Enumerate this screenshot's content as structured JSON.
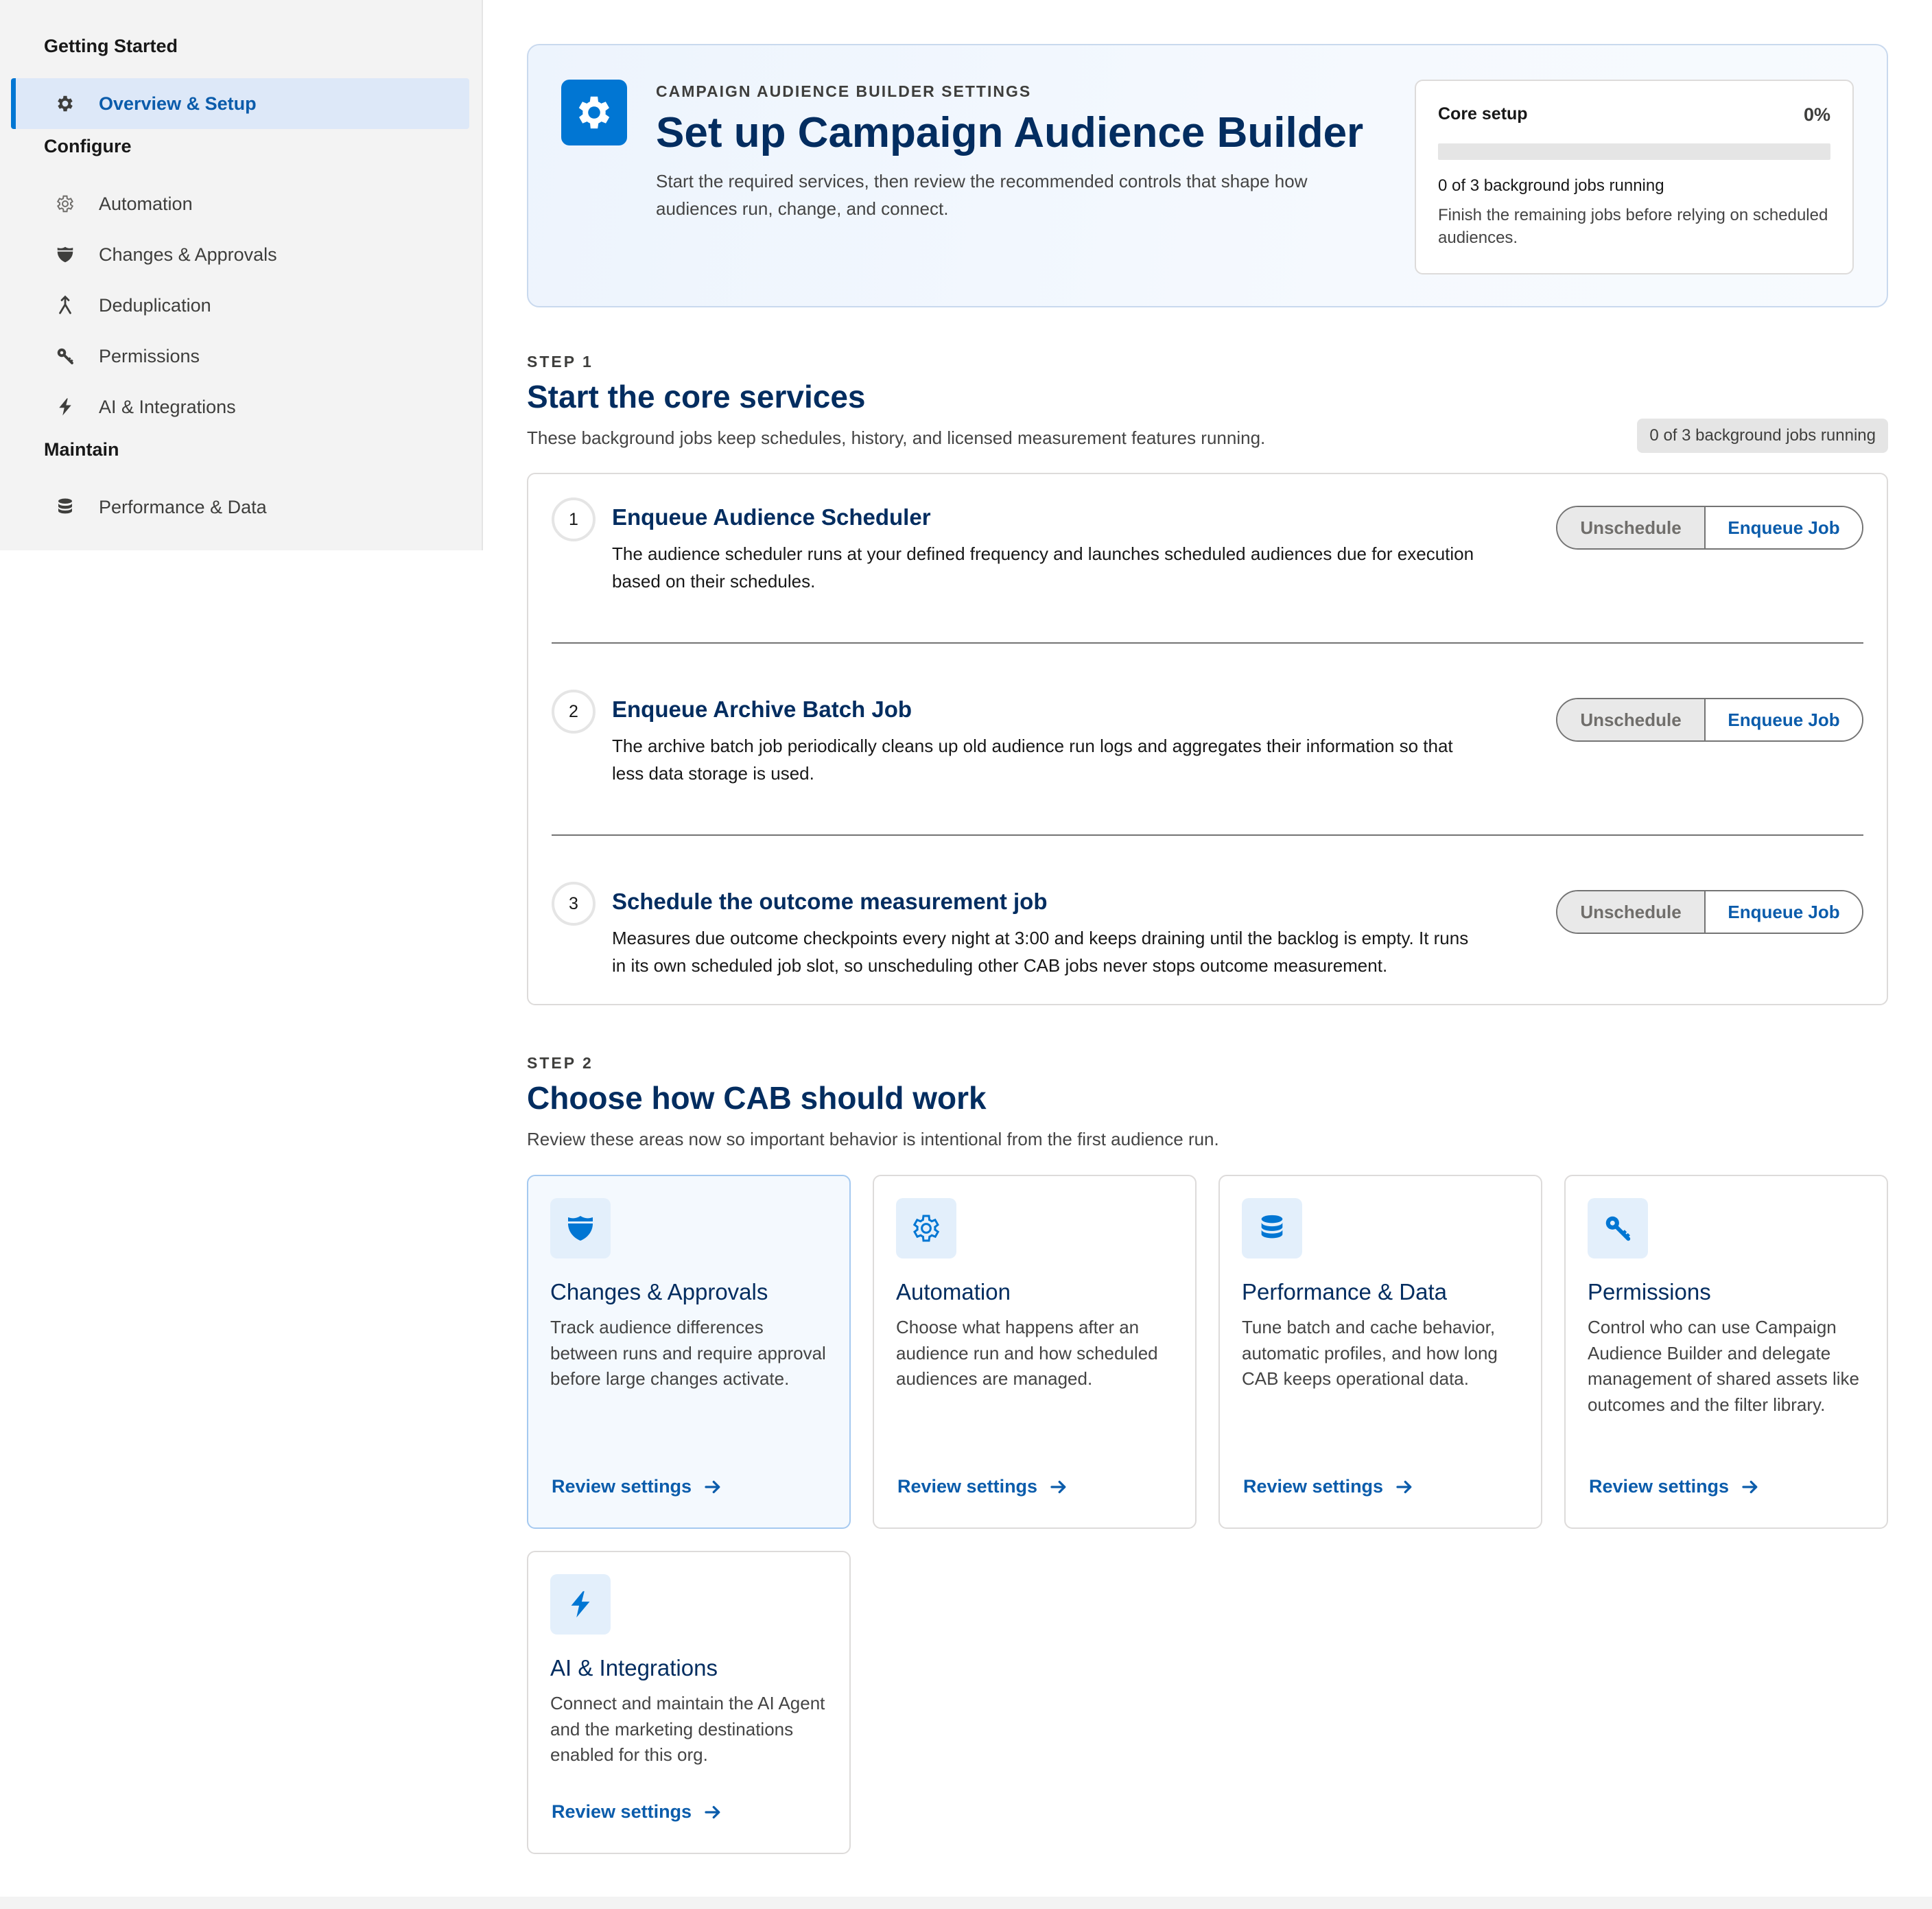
{
  "sidebar": {
    "groups": [
      {
        "label": "Getting Started",
        "items": [
          {
            "label": "Overview & Setup",
            "icon": "gear-icon",
            "active": true
          }
        ]
      },
      {
        "label": "Configure",
        "items": [
          {
            "label": "Automation",
            "icon": "gear-outline-icon"
          },
          {
            "label": "Changes & Approvals",
            "icon": "shield-icon"
          },
          {
            "label": "Deduplication",
            "icon": "merge-icon"
          },
          {
            "label": "Permissions",
            "icon": "key-icon"
          },
          {
            "label": "AI & Integrations",
            "icon": "lightning-icon"
          }
        ]
      },
      {
        "label": "Maintain",
        "items": [
          {
            "label": "Performance & Data",
            "icon": "database-icon"
          }
        ]
      }
    ]
  },
  "hero": {
    "eyebrow": "CAMPAIGN AUDIENCE BUILDER SETTINGS",
    "title": "Set up Campaign Audience Builder",
    "description": "Start the required services, then review the recommended controls that shape how audiences run, change, and connect.",
    "icon": "gear-icon",
    "core": {
      "label": "Core setup",
      "percent_label": "0%",
      "progress": 0,
      "status": "0 of 3 background jobs running",
      "note": "Finish the remaining jobs before relying on scheduled audiences."
    }
  },
  "step1": {
    "label": "STEP 1",
    "title": "Start the core services",
    "description": "These background jobs keep schedules, history, and licensed measurement features running.",
    "badge": "0 of 3 background jobs running",
    "jobs": [
      {
        "number": "1",
        "title": "Enqueue Audience Scheduler",
        "description": "The audience scheduler runs at your defined frequency and launches scheduled audiences due for execution based on their schedules.",
        "unschedule_label": "Unschedule",
        "enqueue_label": "Enqueue Job"
      },
      {
        "number": "2",
        "title": "Enqueue Archive Batch Job",
        "description": "The archive batch job periodically cleans up old audience run logs and aggregates their information so that less data storage is used.",
        "unschedule_label": "Unschedule",
        "enqueue_label": "Enqueue Job"
      },
      {
        "number": "3",
        "title": "Schedule the outcome measurement job",
        "description": "Measures due outcome checkpoints every night at 3:00 and keeps draining until the backlog is empty. It runs in its own scheduled job slot, so unscheduling other CAB jobs never stops outcome measurement.",
        "unschedule_label": "Unschedule",
        "enqueue_label": "Enqueue Job"
      }
    ]
  },
  "step2": {
    "label": "STEP 2",
    "title": "Choose how CAB should work",
    "description": "Review these areas now so important behavior is intentional from the first audience run.",
    "cards": [
      {
        "title": "Changes & Approvals",
        "description": "Track audience differences between runs and require approval before large changes activate.",
        "link": "Review settings",
        "icon": "shield-icon"
      },
      {
        "title": "Automation",
        "description": "Choose what happens after an audience run and how scheduled audiences are managed.",
        "link": "Review settings",
        "icon": "gear-outline-icon"
      },
      {
        "title": "Performance & Data",
        "description": "Tune batch and cache behavior, automatic profiles, and how long CAB keeps operational data.",
        "link": "Review settings",
        "icon": "database-icon"
      },
      {
        "title": "Permissions",
        "description": "Control who can use Campaign Audience Builder and delegate management of shared assets like outcomes and the filter library.",
        "link": "Review settings",
        "icon": "key-icon"
      },
      {
        "title": "AI & Integrations",
        "description": "Connect and maintain the AI Agent and the marketing destinations enabled for this org.",
        "link": "Review settings",
        "icon": "lightning-icon"
      }
    ]
  },
  "colors": {
    "brand": "#0176d3",
    "link": "#0b5cab",
    "heading": "#032d60"
  }
}
